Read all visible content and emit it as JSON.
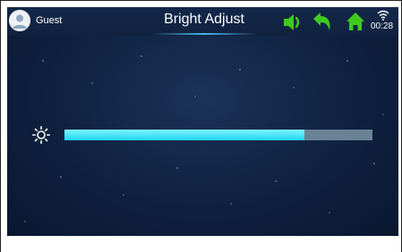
{
  "header": {
    "user_name": "Guest",
    "title": "Bright Adjust",
    "time": "00:28",
    "icons": [
      "avatar-icon",
      "volume-icon",
      "back-icon",
      "home-icon",
      "wifi-icon"
    ]
  },
  "brightness": {
    "icon": "brightness-icon",
    "level": 0.78
  },
  "colors": {
    "accent_green": "#3ecb1e",
    "fill_cyan": "#2ee0f5",
    "track_gray": "#6a8296",
    "background": "#0f2140"
  }
}
